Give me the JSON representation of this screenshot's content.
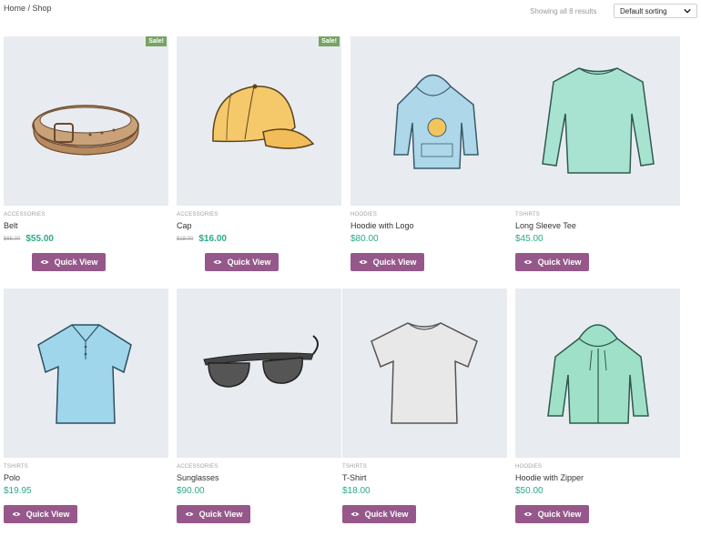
{
  "breadcrumb": "Home / Shop",
  "result_count": "Showing all 8 results",
  "sorting": {
    "selected": "Default sorting"
  },
  "colors": {
    "accent": "#96588a",
    "price": "#2aaa8a",
    "sale": "#77a464",
    "thumb_bg": "#e8ecf0"
  },
  "products": [
    {
      "category": "ACCESSORIES",
      "title": "Belt",
      "sale": "Sale!",
      "old_price": "$65.00",
      "price": "$55.00",
      "button": "Quick View",
      "icon": "belt-image"
    },
    {
      "category": "ACCESSORIES",
      "title": "Cap",
      "sale": "Sale!",
      "old_price": "$18.00",
      "price": "$16.00",
      "button": "Quick View",
      "icon": "cap-image"
    },
    {
      "category": "HOODIES",
      "title": "Hoodie with Logo",
      "price": "$80.00",
      "button": "Quick View",
      "icon": "hoodie-logo-image"
    },
    {
      "category": "TSHIRTS",
      "title": "Long Sleeve Tee",
      "price": "$45.00",
      "button": "Quick View",
      "icon": "long-sleeve-image"
    },
    {
      "category": "TSHIRTS",
      "title": "Polo",
      "price": "$19.95",
      "button": "Quick View",
      "icon": "polo-image"
    },
    {
      "category": "ACCESSORIES",
      "title": "Sunglasses",
      "price": "$90.00",
      "button": "Quick View",
      "icon": "sunglasses-image"
    },
    {
      "category": "TSHIRTS",
      "title": "T-Shirt",
      "price": "$18.00",
      "button": "Quick View",
      "icon": "tshirt-image"
    },
    {
      "category": "HOODIES",
      "title": "Hoodie with Zipper",
      "price": "$50.00",
      "button": "Quick View",
      "icon": "hoodie-zipper-image"
    }
  ]
}
